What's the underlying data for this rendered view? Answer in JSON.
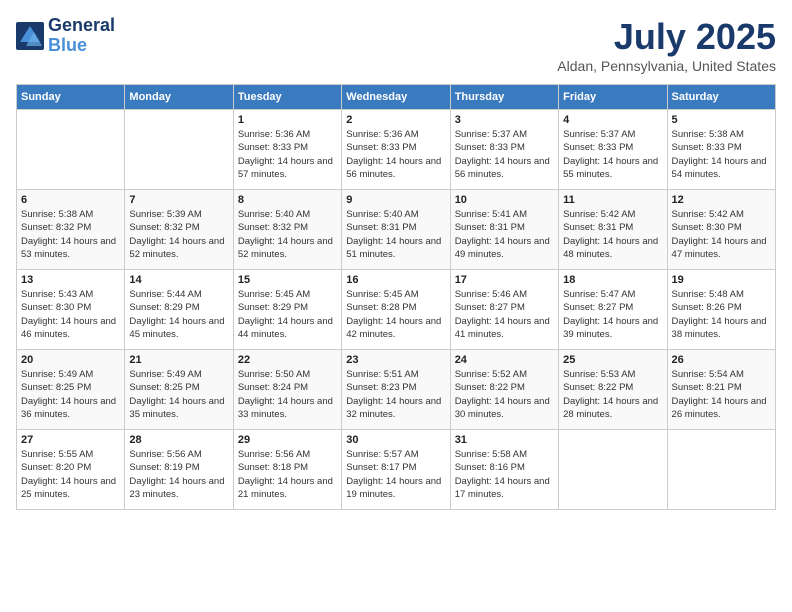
{
  "header": {
    "logo_line1": "General",
    "logo_line2": "Blue",
    "month": "July 2025",
    "location": "Aldan, Pennsylvania, United States"
  },
  "days_of_week": [
    "Sunday",
    "Monday",
    "Tuesday",
    "Wednesday",
    "Thursday",
    "Friday",
    "Saturday"
  ],
  "weeks": [
    [
      {
        "day": "",
        "info": ""
      },
      {
        "day": "",
        "info": ""
      },
      {
        "day": "1",
        "info": "Sunrise: 5:36 AM\nSunset: 8:33 PM\nDaylight: 14 hours and 57 minutes."
      },
      {
        "day": "2",
        "info": "Sunrise: 5:36 AM\nSunset: 8:33 PM\nDaylight: 14 hours and 56 minutes."
      },
      {
        "day": "3",
        "info": "Sunrise: 5:37 AM\nSunset: 8:33 PM\nDaylight: 14 hours and 56 minutes."
      },
      {
        "day": "4",
        "info": "Sunrise: 5:37 AM\nSunset: 8:33 PM\nDaylight: 14 hours and 55 minutes."
      },
      {
        "day": "5",
        "info": "Sunrise: 5:38 AM\nSunset: 8:33 PM\nDaylight: 14 hours and 54 minutes."
      }
    ],
    [
      {
        "day": "6",
        "info": "Sunrise: 5:38 AM\nSunset: 8:32 PM\nDaylight: 14 hours and 53 minutes."
      },
      {
        "day": "7",
        "info": "Sunrise: 5:39 AM\nSunset: 8:32 PM\nDaylight: 14 hours and 52 minutes."
      },
      {
        "day": "8",
        "info": "Sunrise: 5:40 AM\nSunset: 8:32 PM\nDaylight: 14 hours and 52 minutes."
      },
      {
        "day": "9",
        "info": "Sunrise: 5:40 AM\nSunset: 8:31 PM\nDaylight: 14 hours and 51 minutes."
      },
      {
        "day": "10",
        "info": "Sunrise: 5:41 AM\nSunset: 8:31 PM\nDaylight: 14 hours and 49 minutes."
      },
      {
        "day": "11",
        "info": "Sunrise: 5:42 AM\nSunset: 8:31 PM\nDaylight: 14 hours and 48 minutes."
      },
      {
        "day": "12",
        "info": "Sunrise: 5:42 AM\nSunset: 8:30 PM\nDaylight: 14 hours and 47 minutes."
      }
    ],
    [
      {
        "day": "13",
        "info": "Sunrise: 5:43 AM\nSunset: 8:30 PM\nDaylight: 14 hours and 46 minutes."
      },
      {
        "day": "14",
        "info": "Sunrise: 5:44 AM\nSunset: 8:29 PM\nDaylight: 14 hours and 45 minutes."
      },
      {
        "day": "15",
        "info": "Sunrise: 5:45 AM\nSunset: 8:29 PM\nDaylight: 14 hours and 44 minutes."
      },
      {
        "day": "16",
        "info": "Sunrise: 5:45 AM\nSunset: 8:28 PM\nDaylight: 14 hours and 42 minutes."
      },
      {
        "day": "17",
        "info": "Sunrise: 5:46 AM\nSunset: 8:27 PM\nDaylight: 14 hours and 41 minutes."
      },
      {
        "day": "18",
        "info": "Sunrise: 5:47 AM\nSunset: 8:27 PM\nDaylight: 14 hours and 39 minutes."
      },
      {
        "day": "19",
        "info": "Sunrise: 5:48 AM\nSunset: 8:26 PM\nDaylight: 14 hours and 38 minutes."
      }
    ],
    [
      {
        "day": "20",
        "info": "Sunrise: 5:49 AM\nSunset: 8:25 PM\nDaylight: 14 hours and 36 minutes."
      },
      {
        "day": "21",
        "info": "Sunrise: 5:49 AM\nSunset: 8:25 PM\nDaylight: 14 hours and 35 minutes."
      },
      {
        "day": "22",
        "info": "Sunrise: 5:50 AM\nSunset: 8:24 PM\nDaylight: 14 hours and 33 minutes."
      },
      {
        "day": "23",
        "info": "Sunrise: 5:51 AM\nSunset: 8:23 PM\nDaylight: 14 hours and 32 minutes."
      },
      {
        "day": "24",
        "info": "Sunrise: 5:52 AM\nSunset: 8:22 PM\nDaylight: 14 hours and 30 minutes."
      },
      {
        "day": "25",
        "info": "Sunrise: 5:53 AM\nSunset: 8:22 PM\nDaylight: 14 hours and 28 minutes."
      },
      {
        "day": "26",
        "info": "Sunrise: 5:54 AM\nSunset: 8:21 PM\nDaylight: 14 hours and 26 minutes."
      }
    ],
    [
      {
        "day": "27",
        "info": "Sunrise: 5:55 AM\nSunset: 8:20 PM\nDaylight: 14 hours and 25 minutes."
      },
      {
        "day": "28",
        "info": "Sunrise: 5:56 AM\nSunset: 8:19 PM\nDaylight: 14 hours and 23 minutes."
      },
      {
        "day": "29",
        "info": "Sunrise: 5:56 AM\nSunset: 8:18 PM\nDaylight: 14 hours and 21 minutes."
      },
      {
        "day": "30",
        "info": "Sunrise: 5:57 AM\nSunset: 8:17 PM\nDaylight: 14 hours and 19 minutes."
      },
      {
        "day": "31",
        "info": "Sunrise: 5:58 AM\nSunset: 8:16 PM\nDaylight: 14 hours and 17 minutes."
      },
      {
        "day": "",
        "info": ""
      },
      {
        "day": "",
        "info": ""
      }
    ]
  ]
}
